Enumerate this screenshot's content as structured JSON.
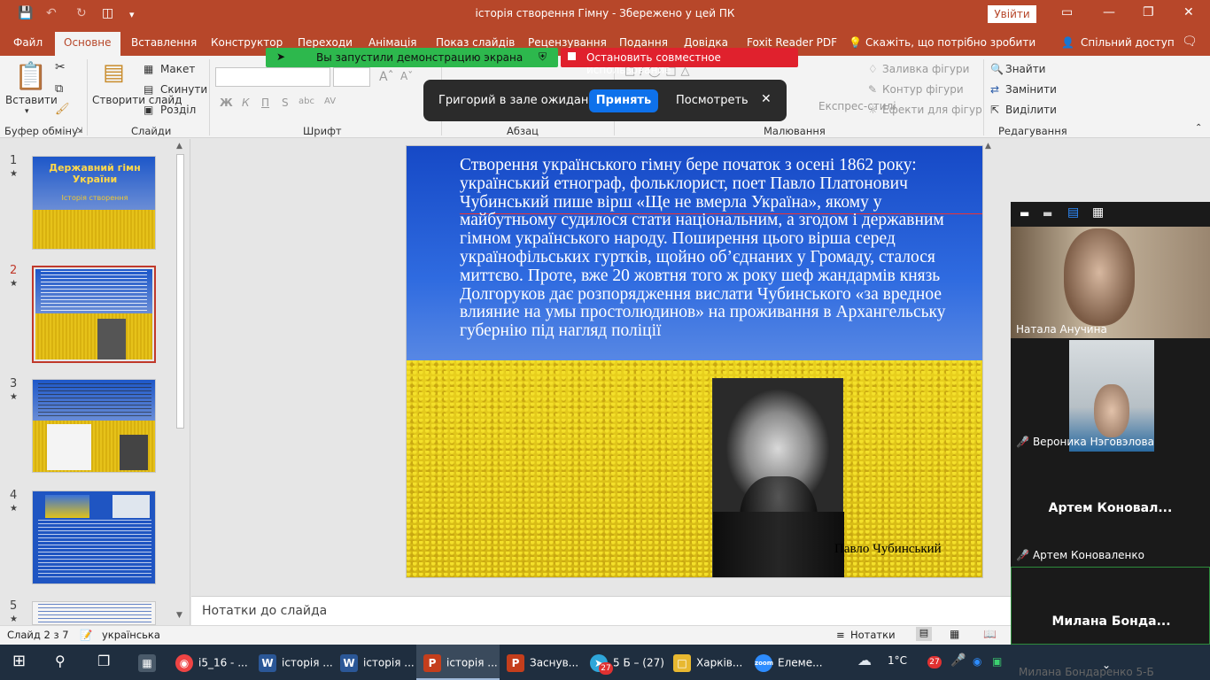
{
  "app": {
    "title": "історія створення Гімну  -  Збережено у цей ПК",
    "sign_in": "Увійти",
    "colors": {
      "accent": "#b7472a",
      "zoom_green": "#2db84d",
      "zoom_red": "#e0212d",
      "zoom_blue": "#0e71eb"
    }
  },
  "tabs": [
    "Файл",
    "Основне",
    "Вставлення",
    "Конструктор",
    "Переходи",
    "Анімація",
    "Показ слайдів",
    "Рецензування",
    "Подання",
    "Довідка",
    "Foxit Reader PDF"
  ],
  "tell_me": "Скажіть, що потрібно зробити",
  "share": "Спільний доступ",
  "ribbon": {
    "paste": "Вставити",
    "new_slide": "Створити слайд",
    "layout": "Макет",
    "reset": "Скинути",
    "section": "Розділ",
    "bold": "Ж",
    "italic": "К",
    "underline": "П",
    "strike": "S",
    "spacing": "abc",
    "shadow": "AV",
    "shape_fill": "Заливка фігури",
    "shape_outline": "Контур фігури",
    "shape_effects": "Ефекти для фігур",
    "arrange": "Упорядити",
    "express_styles": "Експрес-стилі",
    "find": "Знайти",
    "replace": "Замінити",
    "select": "Виділити",
    "groups": {
      "clipboard": "Буфер обміну",
      "slides": "Слайди",
      "font": "Шрифт",
      "paragraph": "Абзац",
      "drawing": "Малювання",
      "editing": "Редагування"
    }
  },
  "zoom_banner": {
    "sharing": "Вы запустили демонстрацию экрана",
    "stop": "Остановить совместное использование",
    "waiting": "Григорий в зале ожидания",
    "accept": "Принять",
    "view": "Посмотреть"
  },
  "thumbnails": [
    {
      "num": "1",
      "title": "Державний гімн України",
      "subtitle": "Історія створення"
    },
    {
      "num": "2"
    },
    {
      "num": "3"
    },
    {
      "num": "4"
    },
    {
      "num": "5"
    }
  ],
  "slide": {
    "text": "Створення українського гімну бере початок з осені 1862 року: український етнограф, фольклорист, поет Павло Платонович Чубинський пише вірш «Ще не вмерла Україна», якому у майбутньому судилося стати національним, а згодом і державним гімном українського народу. Поширення цього вірша серед українофільських гуртків, щойно об’єднаних у Громаду, сталося миттєво. Проте, вже 20 жовтня того ж року шеф жандармів князь Долгоруков дає розпорядження вислати Чубинського «за вредное влияние на умы простолюдинов» на проживання в Архангельську губернію під нагляд поліції",
    "caption": "Павло Чубинський"
  },
  "notes_placeholder": "Нотатки до слайда",
  "status": {
    "slide": "Слайд 2 з 7",
    "language": "українська",
    "notes": "Нотатки"
  },
  "participants": [
    {
      "name": "Натала Анучина",
      "muted": false,
      "video": true
    },
    {
      "name": "Вероника Нэговэлова",
      "muted": true,
      "video": true
    },
    {
      "name": "Артем Коноваленко",
      "display": "Артем  Коновал...",
      "muted": true,
      "video": false
    },
    {
      "display": "Милана  Бонда...",
      "muted": false,
      "video": false
    }
  ],
  "zoom_footer": "Милана Бондаренко 5-Б",
  "taskbar": {
    "items": [
      {
        "label": "i5_16 - ...",
        "icon": "chrome-icon"
      },
      {
        "label": "історія ...",
        "icon": "word-icon"
      },
      {
        "label": "історія ...",
        "icon": "word-icon"
      },
      {
        "label": "історія ...",
        "icon": "powerpoint-icon"
      },
      {
        "label": "Заснув...",
        "icon": "powerpoint-icon"
      },
      {
        "label": "5 Б – (27)",
        "icon": "telegram-icon",
        "badge": "27"
      },
      {
        "label": "Харків...",
        "icon": "folder-icon"
      },
      {
        "label": "Елеме...",
        "icon": "zoom-icon"
      }
    ],
    "weather": "1°C",
    "notif_badge": "27"
  }
}
